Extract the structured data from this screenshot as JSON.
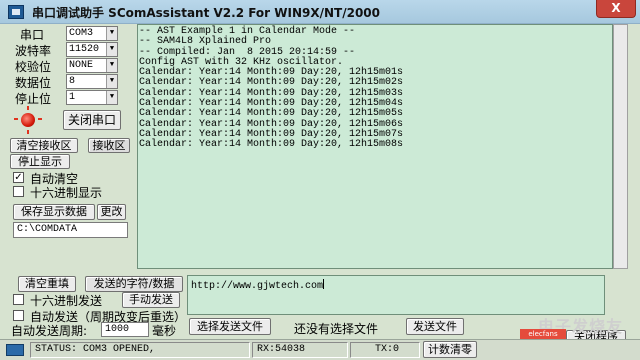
{
  "window": {
    "title": "串口调试助手 SComAssistant V2.2 For WIN9X/NT/2000",
    "close_glyph": "X"
  },
  "port_settings": {
    "port_label": "串口",
    "port_value": "COM3",
    "baud_label": "波特率",
    "baud_value": "11520",
    "parity_label": "校验位",
    "parity_value": "NONE",
    "databits_label": "数据位",
    "databits_value": "8",
    "stopbits_label": "停止位",
    "stopbits_value": "1",
    "close_port_label": "关闭串口",
    "led_color": "#d41a0a"
  },
  "receive_controls": {
    "clear_recv_label": "清空接收区",
    "recv_area_label": "接收区",
    "stop_display_label": "停止显示",
    "auto_clear_label": "自动清空",
    "auto_clear_checked": true,
    "hex_display_label": "十六进制显示",
    "hex_display_checked": false,
    "save_display_label": "保存显示数据",
    "change_label": "更改",
    "save_path": "C:\\COMDATA"
  },
  "receive_text": "-- AST Example 1 in Calendar Mode --\n-- SAM4L8 Xplained Pro\n-- Compiled: Jan  8 2015 20:14:59 --\nConfig AST with 32 KHz oscillator.\nCalendar: Year:14 Month:09 Day:20, 12h15m01s\nCalendar: Year:14 Month:09 Day:20, 12h15m02s\nCalendar: Year:14 Month:09 Day:20, 12h15m03s\nCalendar: Year:14 Month:09 Day:20, 12h15m04s\nCalendar: Year:14 Month:09 Day:20, 12h15m05s\nCalendar: Year:14 Month:09 Day:20, 12h15m06s\nCalendar: Year:14 Month:09 Day:20, 12h15m07s\nCalendar: Year:14 Month:09 Day:20, 12h15m08s",
  "send_controls": {
    "clear_resend_label": "清空重填",
    "send_chars_label": "发送的字符/数据",
    "hex_send_label": "十六进制发送",
    "hex_send_checked": false,
    "manual_send_label": "手动发送",
    "auto_send_label": "自动发送（周期改变后重选）",
    "auto_send_checked": false,
    "period_label": "自动发送周期:",
    "period_value": "1000",
    "period_unit": "毫秒",
    "send_text": "http://www.gjwtech.com",
    "choose_file_label": "选择发送文件",
    "no_file_label": "还没有选择文件",
    "send_file_label": "发送文件",
    "close_program_label": "关闭程序"
  },
  "status_bar": {
    "status": "STATUS: COM3 OPENED,",
    "rx": "RX:54038",
    "tx": "TX:0",
    "count_clear_label": "计数清零"
  },
  "watermark": {
    "text": "电子发烧友",
    "badge": "elecfans"
  }
}
